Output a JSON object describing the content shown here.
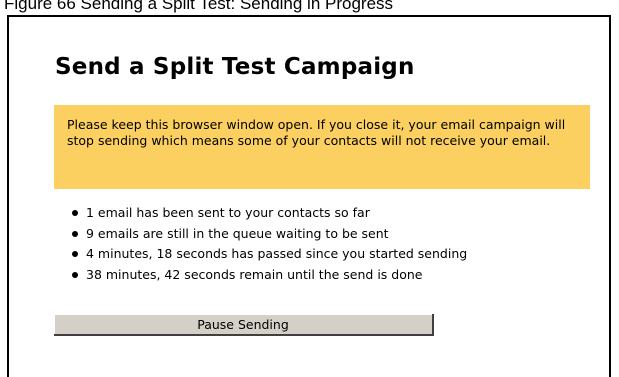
{
  "caption": {
    "text": "Figure 66   Sending a Split Test: Sending in Progress"
  },
  "page": {
    "title": "Send a Split Test Campaign"
  },
  "warning": {
    "text": "Please keep this browser window open. If you close it, your email campaign will stop sending which means some of your contacts will not receive your email.",
    "background_color": "#fcd060"
  },
  "status": {
    "items": [
      "1 email has been sent to your contacts so far",
      "9 emails are still in the queue waiting to be sent",
      "4 minutes, 18 seconds has passed since you started sending",
      "38 minutes, 42 seconds remain until the send is done"
    ]
  },
  "actions": {
    "pause_label": "Pause Sending"
  }
}
